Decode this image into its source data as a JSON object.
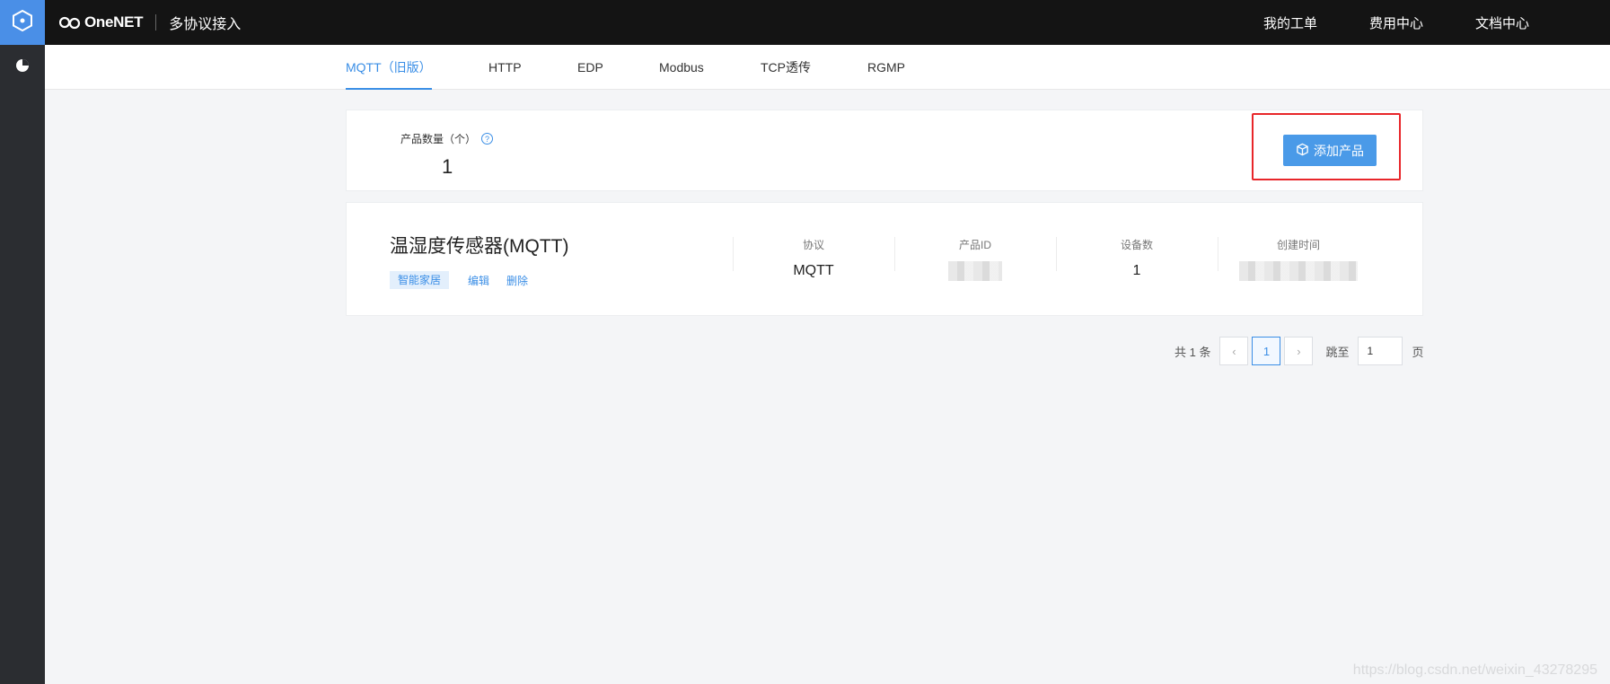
{
  "brand": {
    "name": "OneNET",
    "title": "多协议接入"
  },
  "top_nav": [
    "我的工单",
    "费用中心",
    "文档中心"
  ],
  "tabs": [
    "MQTT（旧版）",
    "HTTP",
    "EDP",
    "Modbus",
    "TCP透传",
    "RGMP"
  ],
  "summary": {
    "label": "产品数量（个）",
    "help": "?",
    "count": "1",
    "add_button": "添加产品"
  },
  "product": {
    "name": "温湿度传感器(MQTT)",
    "tag": "智能家居",
    "edit": "编辑",
    "delete": "删除",
    "columns": [
      {
        "label": "协议",
        "value": "MQTT"
      },
      {
        "label": "产品ID",
        "value": ""
      },
      {
        "label": "设备数",
        "value": "1"
      },
      {
        "label": "创建时间",
        "value": ""
      }
    ]
  },
  "pagination": {
    "total": "共 1 条",
    "prev": "‹",
    "page": "1",
    "next": "›",
    "jump_label": "跳至",
    "jump_value": "1",
    "unit": "页"
  },
  "watermark": "https://blog.csdn.net/weixin_43278295",
  "colors": {
    "accent": "#3a8ee6",
    "button": "#4a9ae8",
    "highlight": "#e8262a",
    "topbar": "#141414",
    "rail": "#2b2d31"
  },
  "icons": {
    "rail_logo": "hexagon-icon",
    "rail_item": "pie-chart-icon",
    "brand": "onenet-logo-icon",
    "add": "cube-icon",
    "help": "question-icon"
  }
}
